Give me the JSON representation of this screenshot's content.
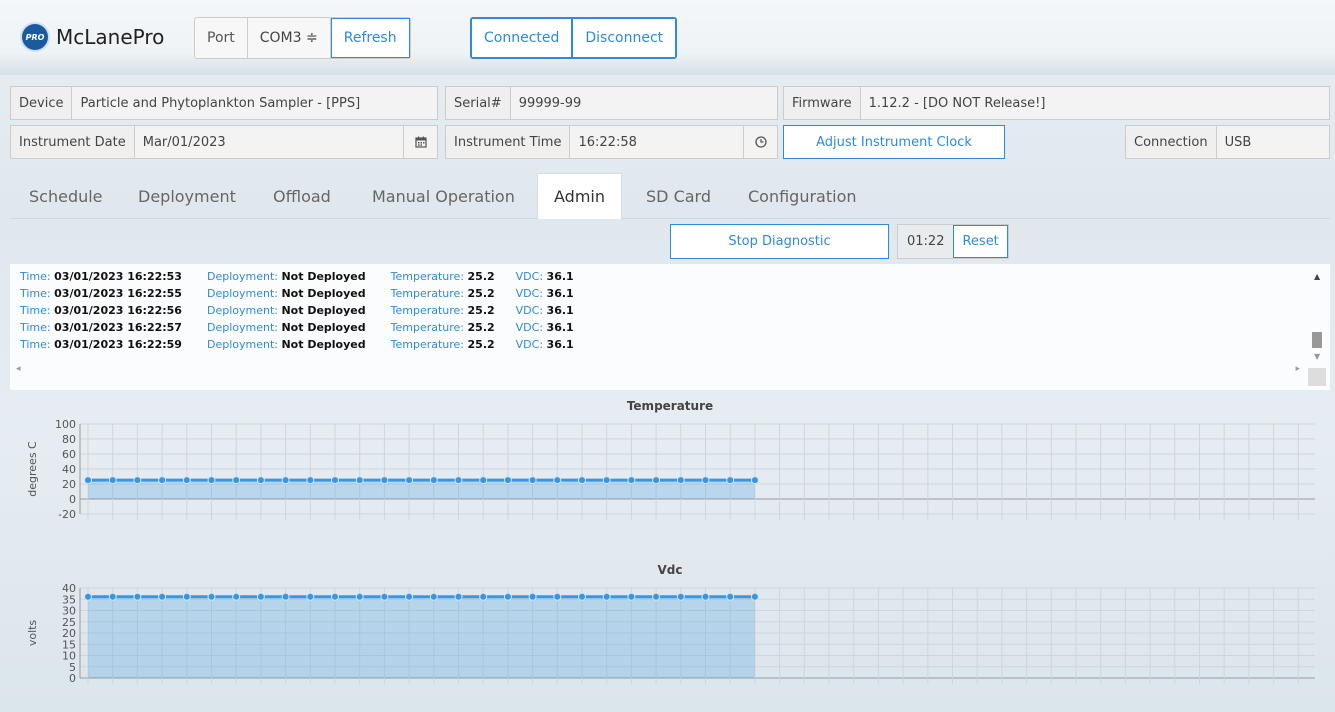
{
  "app": {
    "logo_badge": "PRO",
    "name": "McLanePro"
  },
  "port": {
    "label": "Port",
    "value": "COM3 ≑",
    "refresh": "Refresh"
  },
  "connection_buttons": {
    "connected": "Connected",
    "disconnect": "Disconnect"
  },
  "device": {
    "label": "Device",
    "value": "Particle and Phytoplankton Sampler - [PPS]"
  },
  "serial": {
    "label": "Serial#",
    "value": "99999-99"
  },
  "firmware": {
    "label": "Firmware",
    "value": "1.12.2 - [DO NOT Release!]"
  },
  "instrument_date": {
    "label": "Instrument Date",
    "value": "Mar/01/2023"
  },
  "instrument_time": {
    "label": "Instrument Time",
    "value": "16:22:58"
  },
  "adjust_clock": "Adjust Instrument Clock",
  "connection": {
    "label": "Connection",
    "value": "USB"
  },
  "tabs": [
    {
      "label": "Schedule"
    },
    {
      "label": "Deployment"
    },
    {
      "label": "Offload"
    },
    {
      "label": "Manual Operation"
    },
    {
      "label": "Admin",
      "active": true
    },
    {
      "label": "SD Card"
    },
    {
      "label": "Configuration"
    }
  ],
  "diagnostic": {
    "stop_label": "Stop Diagnostic",
    "timer": "01:22",
    "reset": "Reset"
  },
  "log": {
    "keys": {
      "time": "Time:",
      "deployment": "Deployment:",
      "temperature": "Temperature:",
      "vdc": "VDC:"
    },
    "rows": [
      {
        "time": "03/01/2023 16:22:53",
        "deployment": "Not Deployed",
        "temperature": "25.2",
        "vdc": "36.1"
      },
      {
        "time": "03/01/2023 16:22:55",
        "deployment": "Not Deployed",
        "temperature": "25.2",
        "vdc": "36.1"
      },
      {
        "time": "03/01/2023 16:22:56",
        "deployment": "Not Deployed",
        "temperature": "25.2",
        "vdc": "36.1"
      },
      {
        "time": "03/01/2023 16:22:57",
        "deployment": "Not Deployed",
        "temperature": "25.2",
        "vdc": "36.1"
      },
      {
        "time": "03/01/2023 16:22:59",
        "deployment": "Not Deployed",
        "temperature": "25.2",
        "vdc": "36.1"
      }
    ]
  },
  "chart_data": [
    {
      "type": "area",
      "title": "Temperature",
      "ylabel": "degrees C",
      "ylim": [
        -20,
        100
      ],
      "yticks": [
        100,
        80,
        60,
        40,
        20,
        0,
        -20
      ],
      "total_slots": 50,
      "series": [
        {
          "values": [
            25.2,
            25.2,
            25.2,
            25.2,
            25.2,
            25.2,
            25.2,
            25.2,
            25.2,
            25.2,
            25.2,
            25.2,
            25.2,
            25.2,
            25.2,
            25.2,
            25.2,
            25.2,
            25.2,
            25.2,
            25.2,
            25.2,
            25.2,
            25.2,
            25.2,
            25.2,
            25.2,
            25.2
          ]
        }
      ],
      "grid": true,
      "color": "#3a96df"
    },
    {
      "type": "area",
      "title": "Vdc",
      "ylabel": "volts",
      "ylim": [
        0,
        40
      ],
      "yticks": [
        40,
        35,
        30,
        25,
        20,
        15,
        10,
        5,
        0
      ],
      "total_slots": 50,
      "series": [
        {
          "values": [
            36.1,
            36.1,
            36.1,
            36.1,
            36.1,
            36.1,
            36.1,
            36.1,
            36.1,
            36.1,
            36.1,
            36.1,
            36.1,
            36.1,
            36.1,
            36.1,
            36.1,
            36.1,
            36.1,
            36.1,
            36.1,
            36.1,
            36.1,
            36.1,
            36.1,
            36.1,
            36.1,
            36.1
          ]
        }
      ],
      "grid": true,
      "color": "#3a96df"
    }
  ]
}
